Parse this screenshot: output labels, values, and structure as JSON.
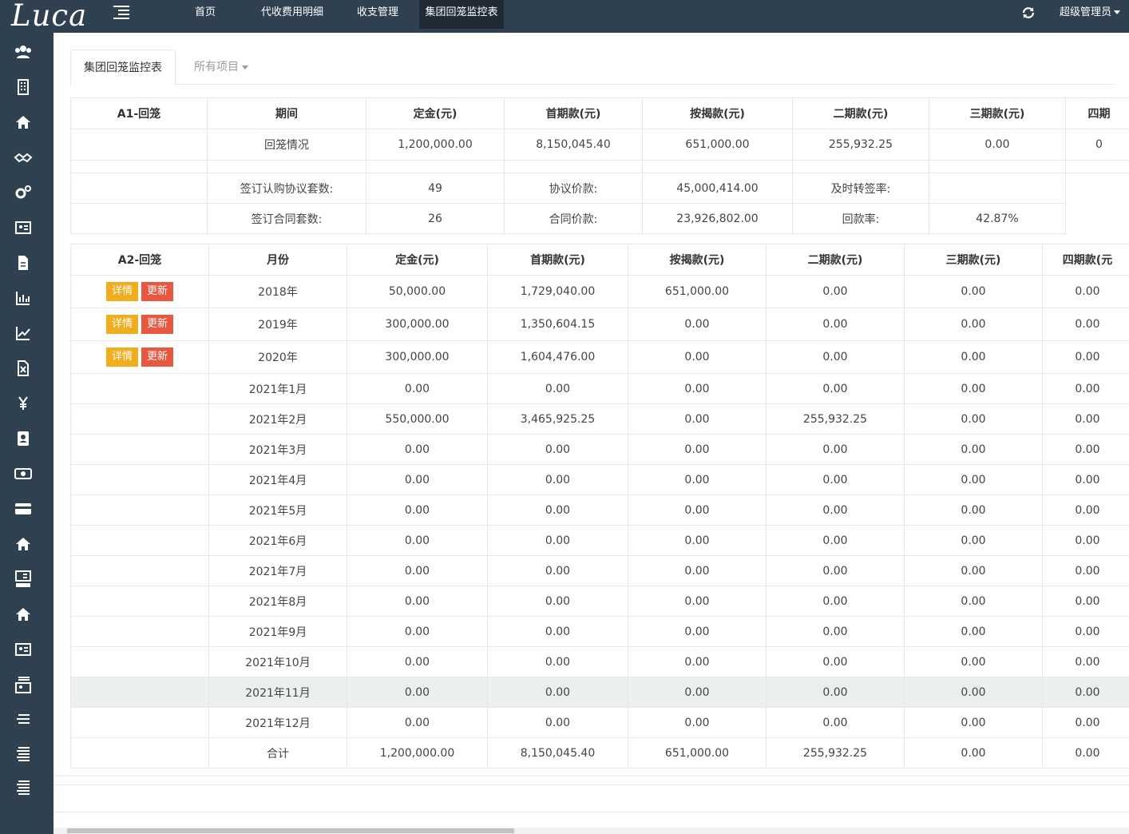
{
  "app": {
    "logo": "Luca"
  },
  "topnav": {
    "items": [
      {
        "label": "首页"
      },
      {
        "label": "代收费用明细"
      },
      {
        "label": "收支管理"
      },
      {
        "label": "集团回笼监控表"
      }
    ],
    "user": "超级管理员"
  },
  "sidebar": {
    "icons": [
      "users-icon",
      "building-icon",
      "home-icon",
      "handshake-icon",
      "gears-icon",
      "id-card-icon",
      "file-icon",
      "bar-chart-icon",
      "line-chart-icon",
      "excel-file-icon",
      "yen-icon",
      "address-book-icon",
      "money-icon",
      "credit-card-icon",
      "home-icon",
      "id-card-list-icon",
      "home-icon",
      "id-card-icon",
      "list-card-icon",
      "list-icon",
      "list-lines-icon",
      "list-lines-icon"
    ]
  },
  "tabs": {
    "active": "集团回笼监控表",
    "projects": "所有项目"
  },
  "a1": {
    "headers": [
      "A1-回笼",
      "期间",
      "定金(元)",
      "首期款(元)",
      "按揭款(元)",
      "二期款(元)",
      "三期款(元)",
      "四期"
    ],
    "row1": [
      "",
      "回笼情况",
      "1,200,000.00",
      "8,150,045.40",
      "651,000.00",
      "255,932.25",
      "0.00",
      "0"
    ],
    "row3": [
      "",
      "签订认购协议套数:",
      "49",
      "协议价款:",
      "45,000,414.00",
      "及时转签率:",
      ""
    ],
    "row4": [
      "",
      "签订合同套数:",
      "26",
      "合同价款:",
      "23,926,802.00",
      "回款率:",
      "42.87%"
    ]
  },
  "a2": {
    "headers": [
      "A2-回笼",
      "月份",
      "定金(元)",
      "首期款(元)",
      "按揭款(元)",
      "二期款(元)",
      "三期款(元)",
      "四期款(元"
    ],
    "detail_label": "详情",
    "update_label": "更新",
    "rows": [
      {
        "month": "2018年",
        "v": [
          "50,000.00",
          "1,729,040.00",
          "651,000.00",
          "0.00",
          "0.00",
          "0.00"
        ],
        "actions": true
      },
      {
        "month": "2019年",
        "v": [
          "300,000.00",
          "1,350,604.15",
          "0.00",
          "0.00",
          "0.00",
          "0.00"
        ],
        "actions": true
      },
      {
        "month": "2020年",
        "v": [
          "300,000.00",
          "1,604,476.00",
          "0.00",
          "0.00",
          "0.00",
          "0.00"
        ],
        "actions": true
      },
      {
        "month": "2021年1月",
        "v": [
          "0.00",
          "0.00",
          "0.00",
          "0.00",
          "0.00",
          "0.00"
        ]
      },
      {
        "month": "2021年2月",
        "v": [
          "550,000.00",
          "3,465,925.25",
          "0.00",
          "255,932.25",
          "0.00",
          "0.00"
        ]
      },
      {
        "month": "2021年3月",
        "v": [
          "0.00",
          "0.00",
          "0.00",
          "0.00",
          "0.00",
          "0.00"
        ]
      },
      {
        "month": "2021年4月",
        "v": [
          "0.00",
          "0.00",
          "0.00",
          "0.00",
          "0.00",
          "0.00"
        ]
      },
      {
        "month": "2021年5月",
        "v": [
          "0.00",
          "0.00",
          "0.00",
          "0.00",
          "0.00",
          "0.00"
        ]
      },
      {
        "month": "2021年6月",
        "v": [
          "0.00",
          "0.00",
          "0.00",
          "0.00",
          "0.00",
          "0.00"
        ]
      },
      {
        "month": "2021年7月",
        "v": [
          "0.00",
          "0.00",
          "0.00",
          "0.00",
          "0.00",
          "0.00"
        ]
      },
      {
        "month": "2021年8月",
        "v": [
          "0.00",
          "0.00",
          "0.00",
          "0.00",
          "0.00",
          "0.00"
        ]
      },
      {
        "month": "2021年9月",
        "v": [
          "0.00",
          "0.00",
          "0.00",
          "0.00",
          "0.00",
          "0.00"
        ]
      },
      {
        "month": "2021年10月",
        "v": [
          "0.00",
          "0.00",
          "0.00",
          "0.00",
          "0.00",
          "0.00"
        ]
      },
      {
        "month": "2021年11月",
        "v": [
          "0.00",
          "0.00",
          "0.00",
          "0.00",
          "0.00",
          "0.00"
        ],
        "highlight": true
      },
      {
        "month": "2021年12月",
        "v": [
          "0.00",
          "0.00",
          "0.00",
          "0.00",
          "0.00",
          "0.00"
        ]
      },
      {
        "month": "合计",
        "v": [
          "1,200,000.00",
          "8,150,045.40",
          "651,000.00",
          "255,932.25",
          "0.00",
          "0.00"
        ]
      }
    ]
  }
}
